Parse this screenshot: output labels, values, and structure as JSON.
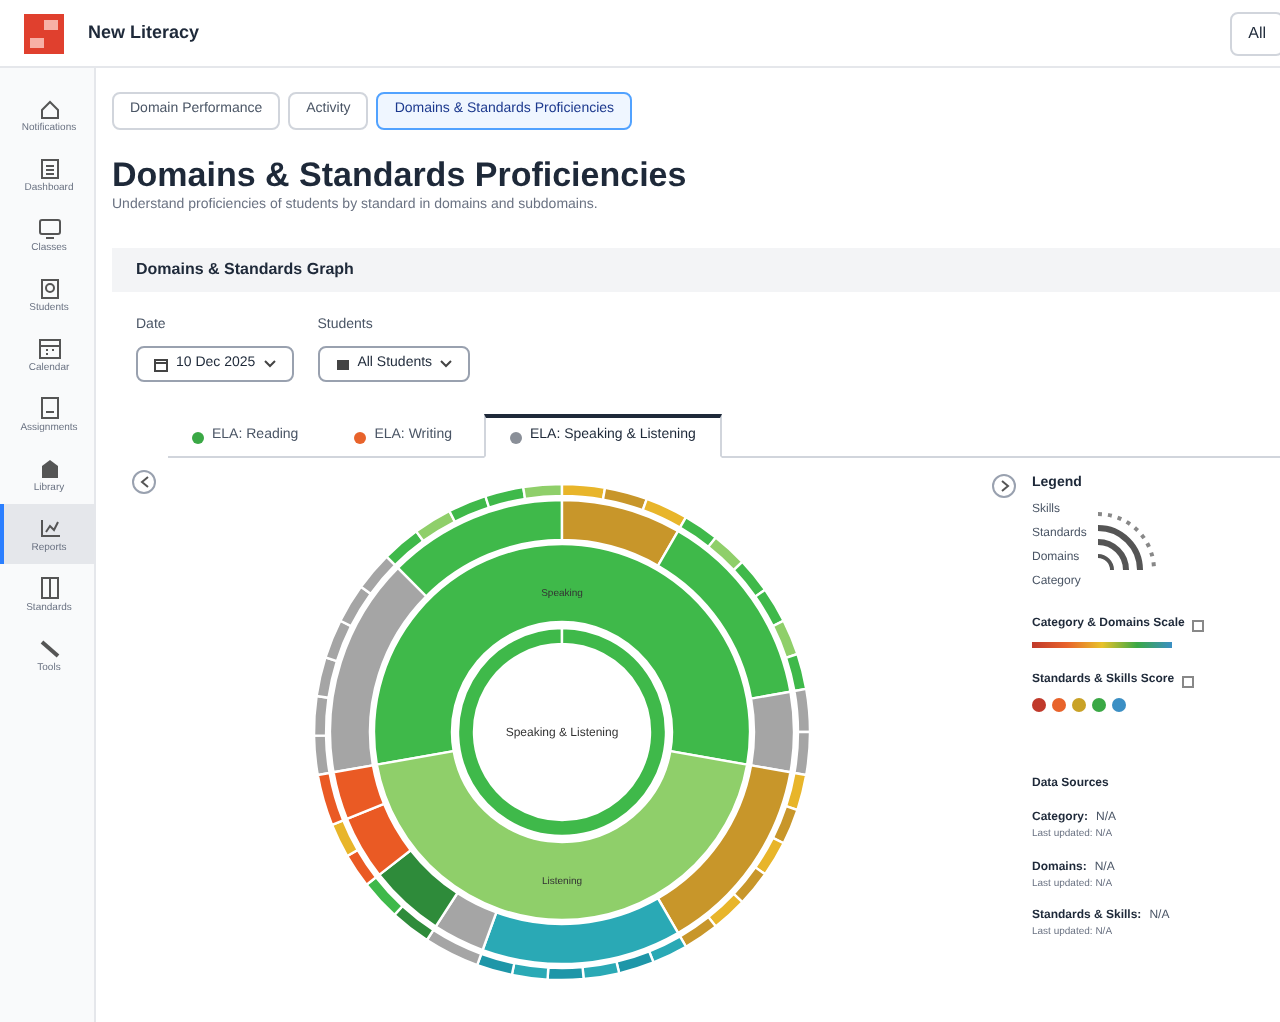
{
  "app": {
    "title": "New Literacy",
    "account": "All"
  },
  "sidebar": {
    "items": [
      {
        "label": "Notifications",
        "selected": false
      },
      {
        "label": "Dashboard",
        "selected": false
      },
      {
        "label": "Classes",
        "selected": false
      },
      {
        "label": "Students",
        "selected": false
      },
      {
        "label": "Calendar",
        "selected": false
      },
      {
        "label": "Assignments",
        "selected": false
      },
      {
        "label": "Library",
        "selected": false
      },
      {
        "label": "Reports",
        "selected": true
      },
      {
        "label": "Standards",
        "selected": false
      },
      {
        "label": "Tools",
        "selected": false
      }
    ]
  },
  "page_tabs": [
    {
      "label": "Domain Performance",
      "selected": false
    },
    {
      "label": "Activity",
      "selected": false
    },
    {
      "label": "Domains & Standards Proficiencies",
      "selected": true
    }
  ],
  "heading": "Domains & Standards Proficiencies",
  "subheading": "Understand proficiencies of students by standard in domains and subdomains.",
  "section": {
    "title": "Domains & Standards Graph",
    "filters": [
      {
        "label": "Date",
        "value": "10 Dec 2025"
      },
      {
        "label": "Students",
        "value": "All Students"
      }
    ],
    "subject_tabs": [
      {
        "label": "ELA: Reading",
        "color": "#3aa845",
        "selected": false
      },
      {
        "label": "ELA: Writing",
        "color": "#e8632b",
        "selected": false
      },
      {
        "label": "ELA: Speaking & Listening",
        "color": "#8a8f98",
        "selected": true
      }
    ],
    "chart": {
      "center_label": "Speaking & Listening",
      "inner_labels": [
        "Speaking",
        "Listening"
      ]
    },
    "legend": {
      "title": "Legend",
      "ring_labels": [
        "Skills",
        "Standards",
        "Domains",
        "Category"
      ],
      "scale_title": "Category & Domains Scale",
      "score_title": "Standards & Skills Score",
      "score_levels": [
        {
          "color": "#c0392b"
        },
        {
          "color": "#e8632b"
        },
        {
          "color": "#c9a227"
        },
        {
          "color": "#3aa845"
        },
        {
          "color": "#3b8fc4"
        }
      ]
    },
    "data_sources": {
      "title": "Data Sources",
      "items": [
        {
          "name": "Category:",
          "value": "N/A",
          "updated": "Last updated: N/A"
        },
        {
          "name": "Domains:",
          "value": "N/A",
          "updated": "Last updated: N/A"
        },
        {
          "name": "Standards & Skills:",
          "value": "N/A",
          "updated": "Last updated: N/A"
        }
      ]
    }
  }
}
